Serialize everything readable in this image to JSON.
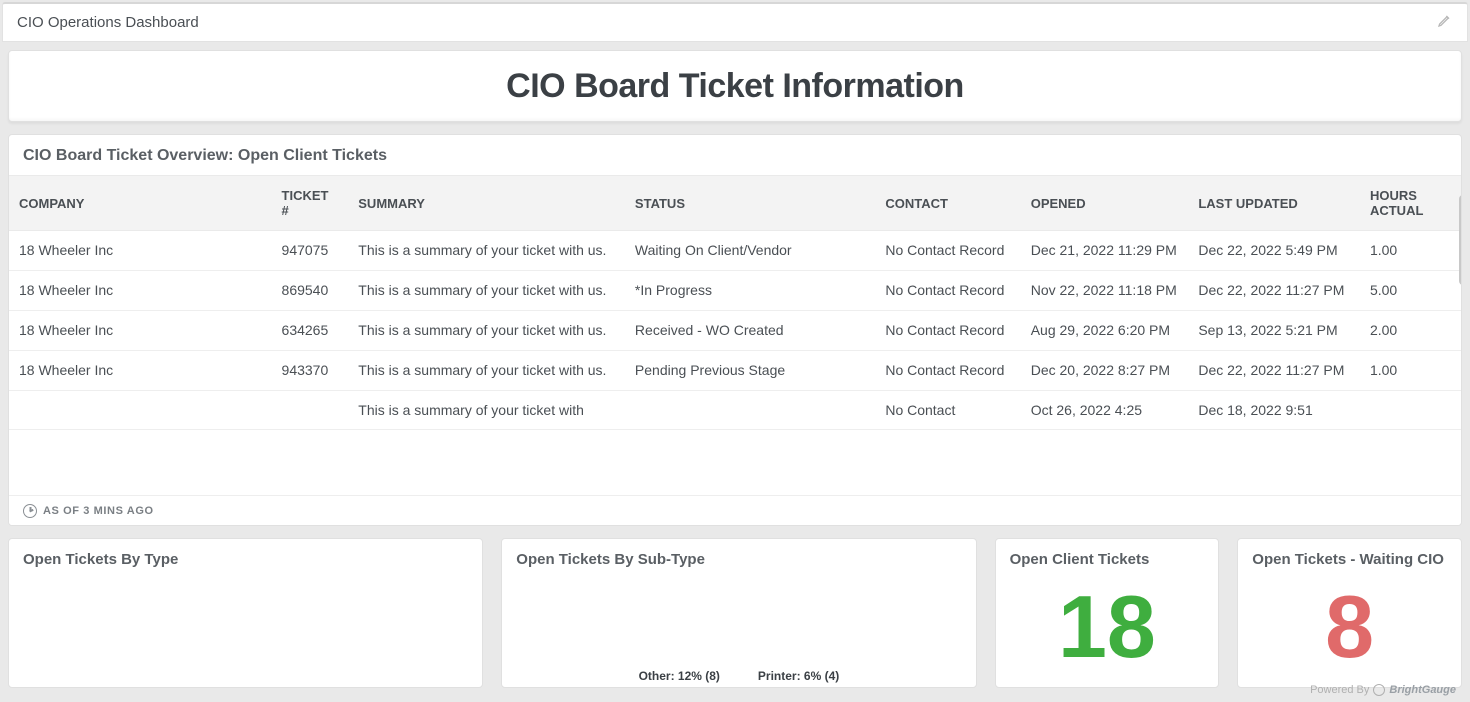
{
  "topbar": {
    "title": "CIO Operations Dashboard"
  },
  "banner": {
    "title": "CIO Board Ticket Information"
  },
  "overview": {
    "title": "CIO Board Ticket Overview: Open Client Tickets",
    "asof": "AS OF 3 MINS AGO",
    "columns": {
      "company": "COMPANY",
      "ticket": "TICKET #",
      "summary": "SUMMARY",
      "status": "STATUS",
      "contact": "CONTACT",
      "opened": "OPENED",
      "updated": "LAST UPDATED",
      "hours": "HOURS ACTUAL"
    },
    "rows": [
      {
        "company": "18 Wheeler Inc",
        "ticket": "947075",
        "summary": "This is a summary of your ticket with us.",
        "status": "Waiting On Client/Vendor",
        "contact": "No Contact Record",
        "opened": "Dec 21, 2022 11:29 PM",
        "updated": "Dec 22, 2022 5:49 PM",
        "hours": "1.00"
      },
      {
        "company": "18 Wheeler Inc",
        "ticket": "869540",
        "summary": "This is a summary of your ticket with us.",
        "status": "*In Progress",
        "contact": "No Contact Record",
        "opened": "Nov 22, 2022 11:18 PM",
        "updated": "Dec 22, 2022 11:27 PM",
        "hours": "5.00"
      },
      {
        "company": "18 Wheeler Inc",
        "ticket": "634265",
        "summary": "This is a summary of your ticket with us.",
        "status": "Received - WO Created",
        "contact": "No Contact Record",
        "opened": "Aug 29, 2022 6:20 PM",
        "updated": "Sep 13, 2022 5:21 PM",
        "hours": "2.00"
      },
      {
        "company": "18 Wheeler Inc",
        "ticket": "943370",
        "summary": "This is a summary of your ticket with us.",
        "status": "Pending Previous Stage",
        "contact": "No Contact Record",
        "opened": "Dec 20, 2022 8:27 PM",
        "updated": "Dec 22, 2022 11:27 PM",
        "hours": "1.00"
      },
      {
        "company": "",
        "ticket": "",
        "summary": "This is a summary of your ticket with",
        "status": "",
        "contact": "No Contact",
        "opened": "Oct 26, 2022 4:25",
        "updated": "Dec 18, 2022 9:51",
        "hours": ""
      }
    ]
  },
  "cards": {
    "type": {
      "title": "Open Tickets By Type"
    },
    "sub": {
      "title": "Open Tickets By Sub-Type"
    },
    "client": {
      "title": "Open Client Tickets",
      "value": "18"
    },
    "wait": {
      "title": "Open Tickets - Waiting CIO",
      "value": "8"
    }
  },
  "chart_data": {
    "type": "pie",
    "title": "Open Tickets By Sub-Type",
    "slices": [
      {
        "label": "Other",
        "percent": 12,
        "count": 8
      },
      {
        "label": "Printer",
        "percent": 6,
        "count": 4
      }
    ],
    "labels": {
      "other": "Other: 12% (8)",
      "printer": "Printer: 6% (4)"
    }
  },
  "footer": {
    "powered": "Powered By",
    "brand": "BrightGauge"
  }
}
